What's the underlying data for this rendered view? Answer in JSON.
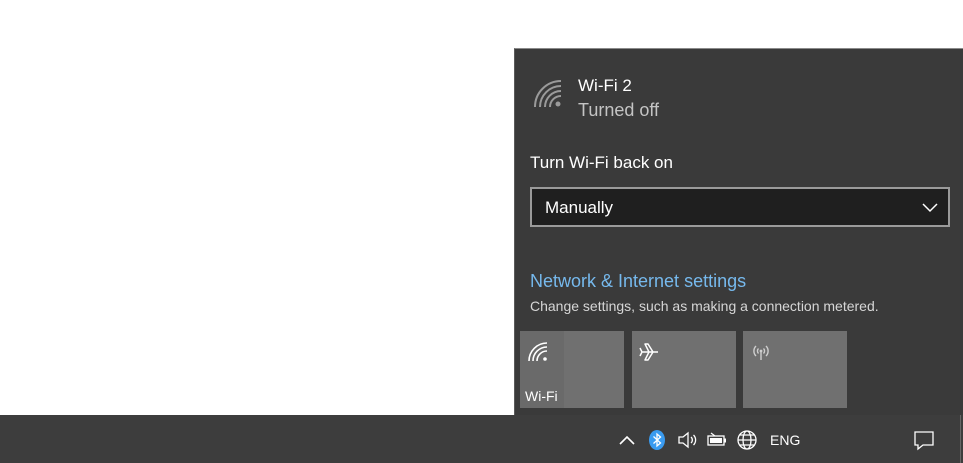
{
  "network": {
    "name": "Wi-Fi 2",
    "status": "Turned off",
    "icon": "wifi-icon"
  },
  "turn_on": {
    "label": "Turn Wi-Fi back on",
    "selected": "Manually"
  },
  "settings": {
    "link": "Network & Internet settings",
    "description": "Change settings, such as making a connection metered."
  },
  "quick_actions": [
    {
      "label": "Wi-Fi",
      "icon": "wifi-icon"
    },
    {
      "label": "",
      "icon": "airplane-icon"
    },
    {
      "label": "",
      "icon": "mobile-hotspot-icon"
    }
  ],
  "taskbar": {
    "language": "ENG",
    "icons": [
      "chevron-up-icon",
      "bluetooth-icon",
      "volume-icon",
      "battery-icon",
      "network-globe-icon",
      "action-center-icon"
    ]
  },
  "colors": {
    "link": "#76b9ed",
    "flyout_bg": "#3a3a3a",
    "taskbar_bg": "#3d3d3d",
    "bluetooth": "#3a9bf0"
  }
}
